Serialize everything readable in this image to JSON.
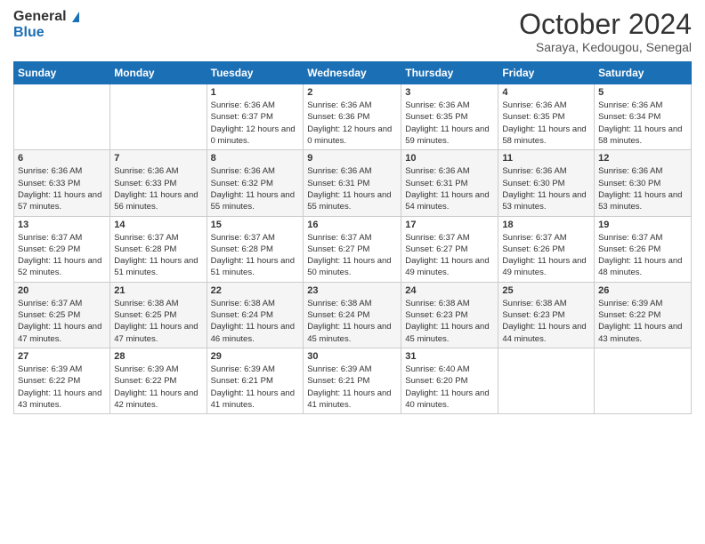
{
  "logo": {
    "line1": "General",
    "line2": "Blue"
  },
  "title": "October 2024",
  "location": "Saraya, Kedougou, Senegal",
  "days_of_week": [
    "Sunday",
    "Monday",
    "Tuesday",
    "Wednesday",
    "Thursday",
    "Friday",
    "Saturday"
  ],
  "weeks": [
    [
      {
        "day": "",
        "sunrise": "",
        "sunset": "",
        "daylight": ""
      },
      {
        "day": "",
        "sunrise": "",
        "sunset": "",
        "daylight": ""
      },
      {
        "day": "1",
        "sunrise": "Sunrise: 6:36 AM",
        "sunset": "Sunset: 6:37 PM",
        "daylight": "Daylight: 12 hours and 0 minutes."
      },
      {
        "day": "2",
        "sunrise": "Sunrise: 6:36 AM",
        "sunset": "Sunset: 6:36 PM",
        "daylight": "Daylight: 12 hours and 0 minutes."
      },
      {
        "day": "3",
        "sunrise": "Sunrise: 6:36 AM",
        "sunset": "Sunset: 6:35 PM",
        "daylight": "Daylight: 11 hours and 59 minutes."
      },
      {
        "day": "4",
        "sunrise": "Sunrise: 6:36 AM",
        "sunset": "Sunset: 6:35 PM",
        "daylight": "Daylight: 11 hours and 58 minutes."
      },
      {
        "day": "5",
        "sunrise": "Sunrise: 6:36 AM",
        "sunset": "Sunset: 6:34 PM",
        "daylight": "Daylight: 11 hours and 58 minutes."
      }
    ],
    [
      {
        "day": "6",
        "sunrise": "Sunrise: 6:36 AM",
        "sunset": "Sunset: 6:33 PM",
        "daylight": "Daylight: 11 hours and 57 minutes."
      },
      {
        "day": "7",
        "sunrise": "Sunrise: 6:36 AM",
        "sunset": "Sunset: 6:33 PM",
        "daylight": "Daylight: 11 hours and 56 minutes."
      },
      {
        "day": "8",
        "sunrise": "Sunrise: 6:36 AM",
        "sunset": "Sunset: 6:32 PM",
        "daylight": "Daylight: 11 hours and 55 minutes."
      },
      {
        "day": "9",
        "sunrise": "Sunrise: 6:36 AM",
        "sunset": "Sunset: 6:31 PM",
        "daylight": "Daylight: 11 hours and 55 minutes."
      },
      {
        "day": "10",
        "sunrise": "Sunrise: 6:36 AM",
        "sunset": "Sunset: 6:31 PM",
        "daylight": "Daylight: 11 hours and 54 minutes."
      },
      {
        "day": "11",
        "sunrise": "Sunrise: 6:36 AM",
        "sunset": "Sunset: 6:30 PM",
        "daylight": "Daylight: 11 hours and 53 minutes."
      },
      {
        "day": "12",
        "sunrise": "Sunrise: 6:36 AM",
        "sunset": "Sunset: 6:30 PM",
        "daylight": "Daylight: 11 hours and 53 minutes."
      }
    ],
    [
      {
        "day": "13",
        "sunrise": "Sunrise: 6:37 AM",
        "sunset": "Sunset: 6:29 PM",
        "daylight": "Daylight: 11 hours and 52 minutes."
      },
      {
        "day": "14",
        "sunrise": "Sunrise: 6:37 AM",
        "sunset": "Sunset: 6:28 PM",
        "daylight": "Daylight: 11 hours and 51 minutes."
      },
      {
        "day": "15",
        "sunrise": "Sunrise: 6:37 AM",
        "sunset": "Sunset: 6:28 PM",
        "daylight": "Daylight: 11 hours and 51 minutes."
      },
      {
        "day": "16",
        "sunrise": "Sunrise: 6:37 AM",
        "sunset": "Sunset: 6:27 PM",
        "daylight": "Daylight: 11 hours and 50 minutes."
      },
      {
        "day": "17",
        "sunrise": "Sunrise: 6:37 AM",
        "sunset": "Sunset: 6:27 PM",
        "daylight": "Daylight: 11 hours and 49 minutes."
      },
      {
        "day": "18",
        "sunrise": "Sunrise: 6:37 AM",
        "sunset": "Sunset: 6:26 PM",
        "daylight": "Daylight: 11 hours and 49 minutes."
      },
      {
        "day": "19",
        "sunrise": "Sunrise: 6:37 AM",
        "sunset": "Sunset: 6:26 PM",
        "daylight": "Daylight: 11 hours and 48 minutes."
      }
    ],
    [
      {
        "day": "20",
        "sunrise": "Sunrise: 6:37 AM",
        "sunset": "Sunset: 6:25 PM",
        "daylight": "Daylight: 11 hours and 47 minutes."
      },
      {
        "day": "21",
        "sunrise": "Sunrise: 6:38 AM",
        "sunset": "Sunset: 6:25 PM",
        "daylight": "Daylight: 11 hours and 47 minutes."
      },
      {
        "day": "22",
        "sunrise": "Sunrise: 6:38 AM",
        "sunset": "Sunset: 6:24 PM",
        "daylight": "Daylight: 11 hours and 46 minutes."
      },
      {
        "day": "23",
        "sunrise": "Sunrise: 6:38 AM",
        "sunset": "Sunset: 6:24 PM",
        "daylight": "Daylight: 11 hours and 45 minutes."
      },
      {
        "day": "24",
        "sunrise": "Sunrise: 6:38 AM",
        "sunset": "Sunset: 6:23 PM",
        "daylight": "Daylight: 11 hours and 45 minutes."
      },
      {
        "day": "25",
        "sunrise": "Sunrise: 6:38 AM",
        "sunset": "Sunset: 6:23 PM",
        "daylight": "Daylight: 11 hours and 44 minutes."
      },
      {
        "day": "26",
        "sunrise": "Sunrise: 6:39 AM",
        "sunset": "Sunset: 6:22 PM",
        "daylight": "Daylight: 11 hours and 43 minutes."
      }
    ],
    [
      {
        "day": "27",
        "sunrise": "Sunrise: 6:39 AM",
        "sunset": "Sunset: 6:22 PM",
        "daylight": "Daylight: 11 hours and 43 minutes."
      },
      {
        "day": "28",
        "sunrise": "Sunrise: 6:39 AM",
        "sunset": "Sunset: 6:22 PM",
        "daylight": "Daylight: 11 hours and 42 minutes."
      },
      {
        "day": "29",
        "sunrise": "Sunrise: 6:39 AM",
        "sunset": "Sunset: 6:21 PM",
        "daylight": "Daylight: 11 hours and 41 minutes."
      },
      {
        "day": "30",
        "sunrise": "Sunrise: 6:39 AM",
        "sunset": "Sunset: 6:21 PM",
        "daylight": "Daylight: 11 hours and 41 minutes."
      },
      {
        "day": "31",
        "sunrise": "Sunrise: 6:40 AM",
        "sunset": "Sunset: 6:20 PM",
        "daylight": "Daylight: 11 hours and 40 minutes."
      },
      {
        "day": "",
        "sunrise": "",
        "sunset": "",
        "daylight": ""
      },
      {
        "day": "",
        "sunrise": "",
        "sunset": "",
        "daylight": ""
      }
    ]
  ]
}
